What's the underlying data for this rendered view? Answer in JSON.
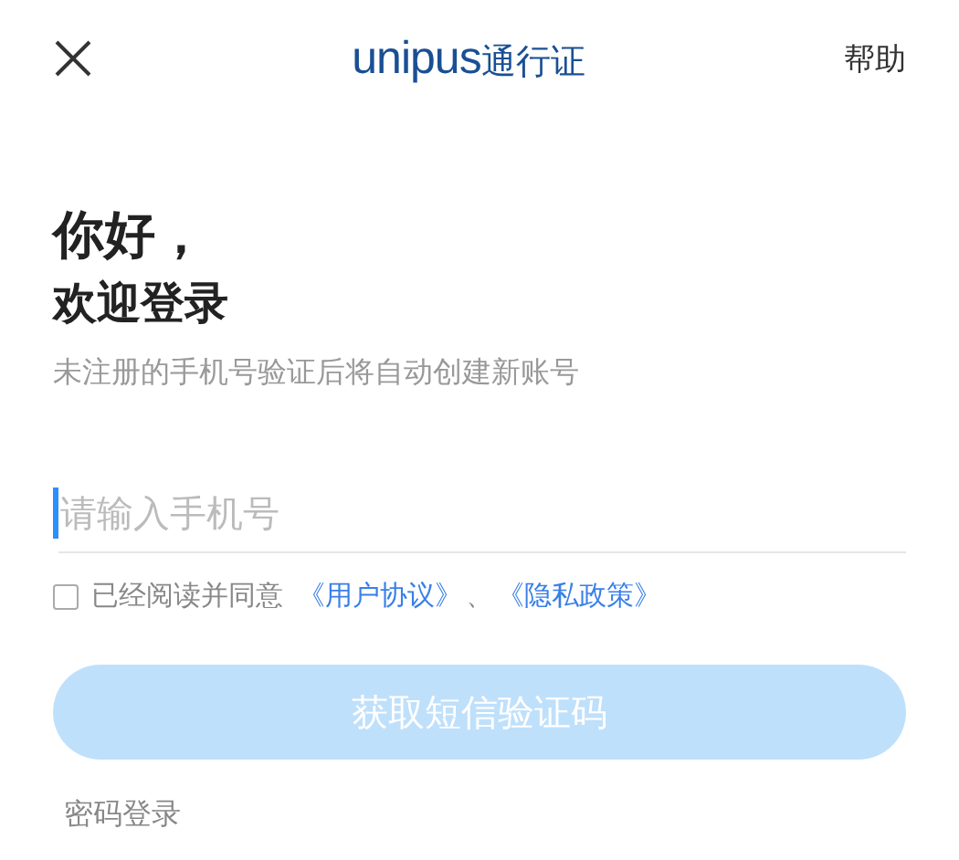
{
  "header": {
    "logo_latin": "unipus",
    "logo_cjk": "通行证",
    "help": "帮助"
  },
  "greeting": "你好，",
  "welcome": "欢迎登录",
  "subtitle": "未注册的手机号验证后将自动创建新账号",
  "phone_field": {
    "placeholder": "请输入手机号",
    "focused": true
  },
  "agreement": {
    "checked": false,
    "text": "已经阅读并同意",
    "links": [
      "《用户协议》",
      "《隐私政策》"
    ],
    "separator": "、"
  },
  "submit_button": {
    "label": "获取短信验证码",
    "disabled": true
  },
  "alt_login": "密码登录"
}
